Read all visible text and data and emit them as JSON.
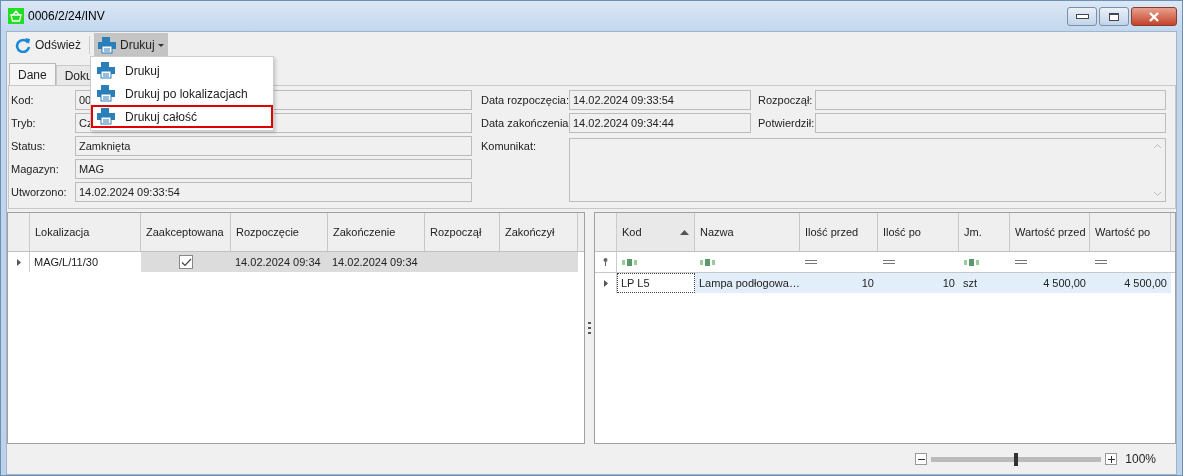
{
  "window": {
    "title": "0006/2/24/INV"
  },
  "toolbar": [
    {
      "label": "Odśwież",
      "kind": "refresh",
      "selected": false
    },
    {
      "label": "Drukuj",
      "kind": "print",
      "selected": true
    }
  ],
  "print_menu": [
    {
      "label": "Drukuj",
      "highlighted": false
    },
    {
      "label": "Drukuj po lokalizacjach",
      "highlighted": false
    },
    {
      "label": "Drukuj całość",
      "highlighted": true
    }
  ],
  "tabs": [
    {
      "label": "Dane",
      "selected": true
    },
    {
      "label": "Doku",
      "selected": false
    }
  ],
  "form": {
    "left": [
      {
        "label": "Kod:",
        "value": "00"
      },
      {
        "label": "Tryb:",
        "value": "Cz"
      },
      {
        "label": "Status:",
        "value": "Zamknięta"
      },
      {
        "label": "Magazyn:",
        "value": "MAG"
      },
      {
        "label": "Utworzono:",
        "value": "14.02.2024 09:33:54"
      }
    ],
    "middle": [
      {
        "label": "Data rozpoczęcia:",
        "value": "14.02.2024 09:33:54"
      },
      {
        "label": "Data zakończenia:",
        "value": "14.02.2024 09:34:44"
      }
    ],
    "right": [
      {
        "label": "Rozpoczął:"
      },
      {
        "label": "Potwierdził:"
      }
    ],
    "message": {
      "label": "Komunikat:"
    }
  },
  "locations_table": {
    "columns": [
      {
        "label": "Lokalizacja"
      },
      {
        "label": "Zaakceptowana"
      },
      {
        "label": "Rozpoczęcie"
      },
      {
        "label": "Zakończenie"
      },
      {
        "label": "Rozpoczął"
      },
      {
        "label": "Zakończył"
      }
    ],
    "rows": [
      {
        "selected": true,
        "location": "MAG/L/11/30",
        "accepted": true,
        "start": "14.02.2024 09:34",
        "end": "14.02.2024 09:34"
      }
    ]
  },
  "items_table": {
    "columns": [
      {
        "label": "Kod",
        "sorted": true,
        "kind": "text"
      },
      {
        "label": "Nazwa",
        "sorted": false,
        "kind": "text"
      },
      {
        "label": "Ilość przed",
        "sorted": false,
        "kind": "number"
      },
      {
        "label": "Ilość po",
        "sorted": false,
        "kind": "number"
      },
      {
        "label": "Jm.",
        "sorted": false,
        "kind": "text"
      },
      {
        "label": "Wartość przed",
        "sorted": false,
        "kind": "number"
      },
      {
        "label": "Wartość po",
        "sorted": false,
        "kind": "number"
      }
    ],
    "rows": [
      {
        "selected": true,
        "cells": [
          "LP L5",
          "Lampa podłogowa…",
          "10",
          "10",
          "szt",
          "4 500,00",
          "4 500,00"
        ]
      }
    ]
  },
  "zoom": {
    "level": 0.5,
    "reading": "100%"
  }
}
